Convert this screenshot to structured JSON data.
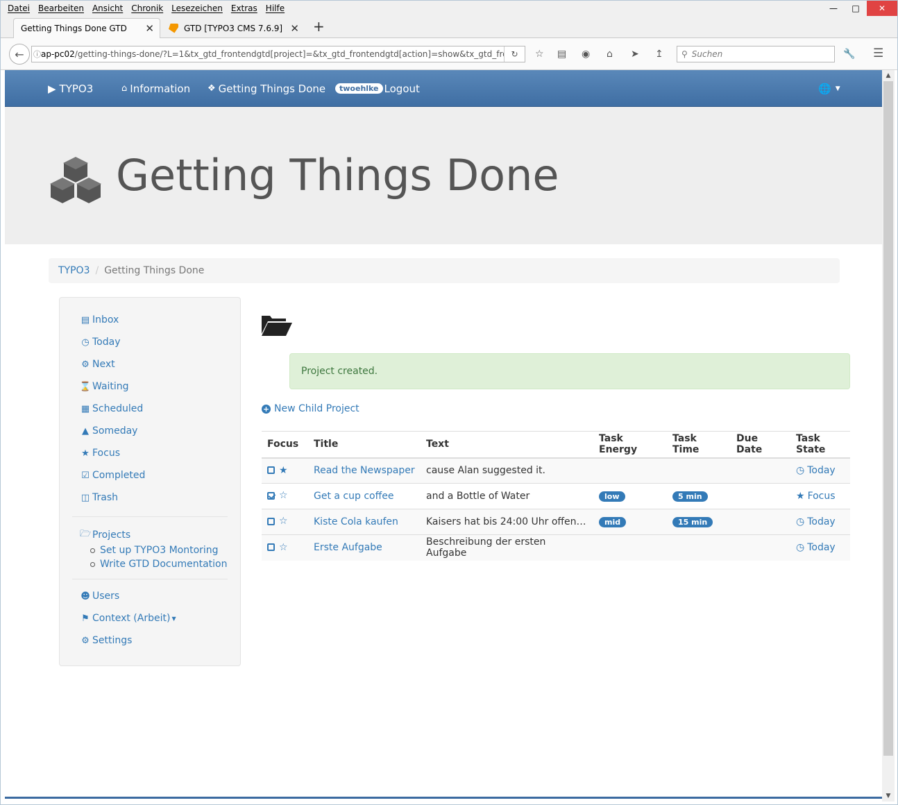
{
  "browser": {
    "menu": [
      "Datei",
      "Bearbeiten",
      "Ansicht",
      "Chronik",
      "Lesezeichen",
      "Extras",
      "Hilfe"
    ],
    "tabs": [
      {
        "title": "Getting Things Done GTD"
      },
      {
        "title": "GTD [TYPO3 CMS 7.6.9]"
      }
    ],
    "url_host": "ap-pc02",
    "url_rest": "/getting-things-done/?L=1&tx_gtd_frontendgtd[project]=&tx_gtd_frontendgtd[action]=show&tx_gtd_fronter",
    "search_placeholder": "Suchen"
  },
  "topnav": {
    "brand": "TYPO3",
    "items": [
      "Information",
      "Getting Things Done"
    ],
    "user_badge": "twoehlke",
    "logout": "Logout"
  },
  "header": {
    "title": "Getting Things Done"
  },
  "breadcrumb": [
    "TYPO3",
    "Getting Things Done"
  ],
  "sidebar": {
    "items": [
      "Inbox",
      "Today",
      "Next",
      "Waiting",
      "Scheduled",
      "Someday",
      "Focus",
      "Completed",
      "Trash"
    ],
    "projects_label": "Projects",
    "projects": [
      "Set up TYPO3 Montoring",
      "Write GTD Documentation"
    ],
    "bottom": [
      "Users",
      "Context (Arbeit)",
      "Settings"
    ]
  },
  "alert": "Project created.",
  "new_child": "New Child Project",
  "table": {
    "headers": [
      "Focus",
      "Title",
      "Text",
      "Task Energy",
      "Task Time",
      "Due Date",
      "Task State"
    ],
    "rows": [
      {
        "checked": false,
        "star": "filled",
        "title": "Read the Newspaper",
        "text": "cause Alan suggested it.",
        "energy": "",
        "time": "",
        "due": "",
        "state": "Today",
        "state_icon": "clock-icon"
      },
      {
        "checked": true,
        "star": "outline",
        "title": "Get a cup coffee",
        "text": "and a Bottle of Water",
        "energy": "low",
        "time": "5 min",
        "due": "",
        "state": "Focus",
        "state_icon": "star-icon"
      },
      {
        "checked": false,
        "star": "outline",
        "title": "Kiste Cola kaufen",
        "text": "Kaisers hat bis 24:00 Uhr offen…",
        "energy": "mid",
        "time": "15 min",
        "due": "",
        "state": "Today",
        "state_icon": "clock-icon"
      },
      {
        "checked": false,
        "star": "outline",
        "title": "Erste Aufgabe",
        "text": "Beschreibung der ersten Aufgabe",
        "energy": "",
        "time": "",
        "due": "",
        "state": "Today",
        "state_icon": "clock-icon"
      }
    ]
  },
  "colors": {
    "link": "#337ab7",
    "navbar": "#4a79ad",
    "alert_bg": "#dff0d8"
  }
}
